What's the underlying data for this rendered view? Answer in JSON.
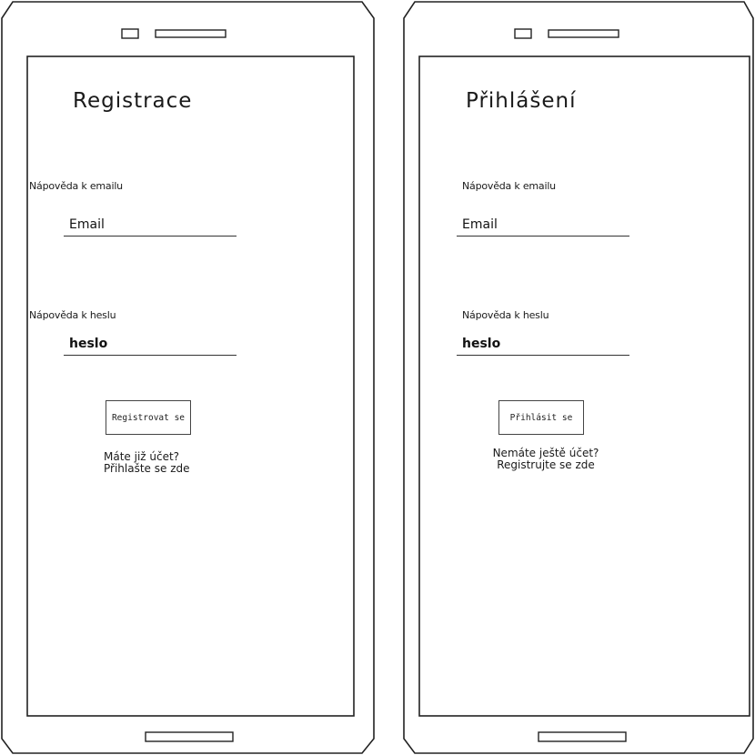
{
  "screens": [
    {
      "title": "Registrace",
      "email_hint": "Nápověda k emailu",
      "email_value": "Email",
      "password_hint": "Nápověda k heslu",
      "password_value": "heslo",
      "button_label": "Registrovat se",
      "link_line1": "Máte již účet?",
      "link_line2": "Přihlašte se zde"
    },
    {
      "title": "Přihlášení",
      "email_hint": "Nápověda k emailu",
      "email_value": "Email",
      "password_hint": "Nápověda k heslu",
      "password_value": "heslo",
      "button_label": "Přihlásit se",
      "link_line1": "Nemáte ještě účet?",
      "link_line2": "Registrujte se zde"
    }
  ]
}
